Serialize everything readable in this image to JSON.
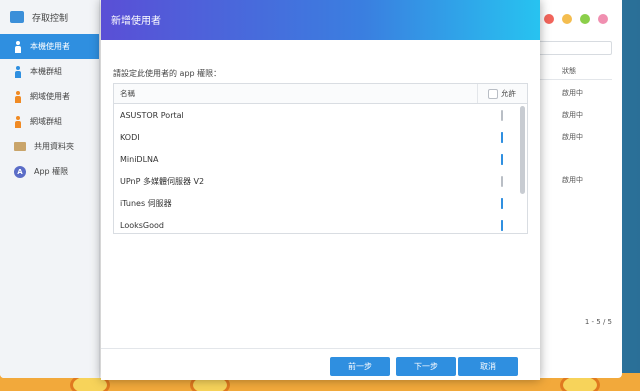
{
  "sidebar": {
    "title": "存取控制",
    "items": [
      {
        "label": "本機使用者"
      },
      {
        "label": "本機群組"
      },
      {
        "label": "網域使用者"
      },
      {
        "label": "網域群組"
      },
      {
        "label": "共用資料夾"
      },
      {
        "label": "App 權限"
      }
    ]
  },
  "background_table": {
    "status_header": "狀態",
    "rows": [
      "啟用中",
      "啟用中",
      "啟用中",
      "啟用中"
    ],
    "pagination": "1 - 5 / 5"
  },
  "window_buttons": [
    "#f2655c",
    "#f4bd4f",
    "#8bcf4a",
    "#f08fb0"
  ],
  "dialog": {
    "title": "新增使用者",
    "instruction": "請設定此使用者的 app 權限：",
    "columns": {
      "name": "名稱",
      "allow": "允許"
    },
    "apps": [
      {
        "name": "ASUSTOR Portal",
        "allowed": false
      },
      {
        "name": "KODI",
        "allowed": true
      },
      {
        "name": "MiniDLNA",
        "allowed": true
      },
      {
        "name": "UPnP 多媒體伺服器 V2",
        "allowed": false
      },
      {
        "name": "iTunes 伺服器",
        "allowed": true
      },
      {
        "name": "LooksGood",
        "allowed": true
      }
    ],
    "buttons": {
      "prev": "前一步",
      "next": "下一步",
      "cancel": "取消"
    }
  },
  "colors": {
    "accent": "#2f8fe0",
    "header_start": "#5a4fd6",
    "header_end": "#27c3f0"
  }
}
